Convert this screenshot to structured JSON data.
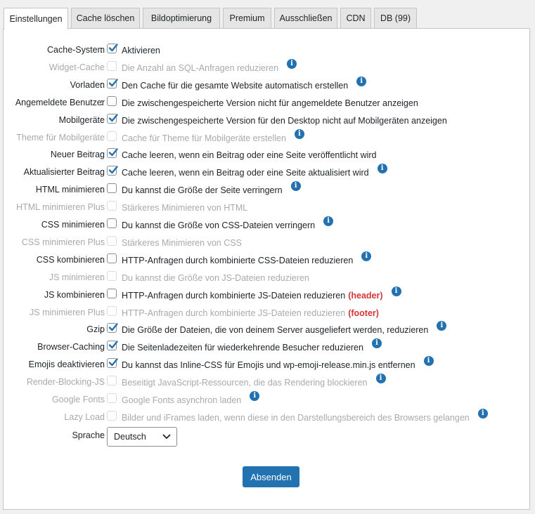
{
  "tabs": [
    {
      "label": "Einstellungen",
      "active": true
    },
    {
      "label": "Cache löschen"
    },
    {
      "label": "Bildoptimierung"
    },
    {
      "label": "Premium"
    },
    {
      "label": "Ausschließen"
    },
    {
      "label": "CDN"
    },
    {
      "label": "DB (99)"
    }
  ],
  "rows": [
    {
      "label": "Cache-System",
      "desc": "Aktivieren",
      "checked": true,
      "disabled": false,
      "info": false
    },
    {
      "label": "Widget-Cache",
      "desc": "Die Anzahl an SQL-Anfragen reduzieren",
      "checked": false,
      "disabled": true,
      "info": true
    },
    {
      "label": "Vorladen",
      "desc": "Den Cache für die gesamte Website automatisch erstellen",
      "checked": true,
      "disabled": false,
      "info": true
    },
    {
      "label": "Angemeldete Benutzer",
      "desc": "Die zwischengespeicherte Version nicht für angemeldete Benutzer anzeigen",
      "checked": false,
      "disabled": false,
      "info": false
    },
    {
      "label": "Mobilgeräte",
      "desc": "Die zwischengespeicherte Version für den Desktop nicht auf Mobilgeräten anzeigen",
      "checked": true,
      "disabled": false,
      "info": false
    },
    {
      "label": "Theme für Mobilgeräte",
      "desc": "Cache für Theme für Mobilgeräte erstellen",
      "checked": false,
      "disabled": true,
      "info": true
    },
    {
      "label": "Neuer Beitrag",
      "desc": "Cache leeren, wenn ein Beitrag oder eine Seite veröffentlicht wird",
      "checked": true,
      "disabled": false,
      "info": false
    },
    {
      "label": "Aktualisierter Beitrag",
      "desc": "Cache leeren, wenn ein Beitrag oder eine Seite aktualisiert wird",
      "checked": true,
      "disabled": false,
      "info": true
    },
    {
      "label": "HTML minimieren",
      "desc": "Du kannst die Größe der Seite verringern",
      "checked": false,
      "disabled": false,
      "info": true
    },
    {
      "label": "HTML minimieren Plus",
      "desc": "Stärkeres Minimieren von HTML",
      "checked": false,
      "disabled": true,
      "info": false
    },
    {
      "label": "CSS minimieren",
      "desc": "Du kannst die Größe von CSS-Dateien verringern",
      "checked": false,
      "disabled": false,
      "info": true
    },
    {
      "label": "CSS minimieren Plus",
      "desc": "Stärkeres Minimieren von CSS",
      "checked": false,
      "disabled": true,
      "info": false
    },
    {
      "label": "CSS kombinieren",
      "desc": "HTTP-Anfragen durch kombinierte CSS-Dateien reduzieren",
      "checked": false,
      "disabled": false,
      "info": true
    },
    {
      "label": "JS minimieren",
      "desc": "Du kannst die Größe von JS-Dateien reduzieren",
      "checked": false,
      "disabled": true,
      "info": false
    },
    {
      "label": "JS kombinieren",
      "desc": "HTTP-Anfragen durch kombinierte JS-Dateien reduzieren",
      "extra": "(header)",
      "checked": false,
      "disabled": false,
      "info": true
    },
    {
      "label": "JS minimieren Plus",
      "desc": "HTTP-Anfragen durch kombinierte JS-Dateien reduzieren",
      "extra": "(footer)",
      "checked": false,
      "disabled": true,
      "info": false
    },
    {
      "label": "Gzip",
      "desc": "Die Größe der Dateien, die von deinem Server ausgeliefert werden, reduzieren",
      "checked": true,
      "disabled": false,
      "info": true
    },
    {
      "label": "Browser-Caching",
      "desc": "Die Seitenladezeiten für wiederkehrende Besucher reduzieren",
      "checked": true,
      "disabled": false,
      "info": true
    },
    {
      "label": "Emojis deaktivieren",
      "desc": "Du kannst das Inline-CSS für Emojis und wp-emoji-release.min.js entfernen",
      "checked": true,
      "disabled": false,
      "info": true
    },
    {
      "label": "Render-Blocking-JS",
      "desc": "Beseitigt JavaScript-Ressourcen, die das Rendering blockieren",
      "checked": false,
      "disabled": true,
      "info": true
    },
    {
      "label": "Google Fonts",
      "desc": "Google Fonts asynchron laden",
      "checked": false,
      "disabled": true,
      "info": true
    },
    {
      "label": "Lazy Load",
      "desc": "Bilder und iFrames laden, wenn diese in den Darstellungsbereich des Browsers gelangen",
      "checked": false,
      "disabled": true,
      "info": true
    }
  ],
  "language": {
    "label": "Sprache",
    "value": "Deutsch"
  },
  "submit_label": "Absenden",
  "colors": {
    "accent": "#2271b1",
    "highlight": "#d63638",
    "disabled": "#a7aaad"
  },
  "icons": {
    "info": "info-icon",
    "checkmark": "checkmark-icon",
    "dropdown": "chevron-down-icon"
  }
}
